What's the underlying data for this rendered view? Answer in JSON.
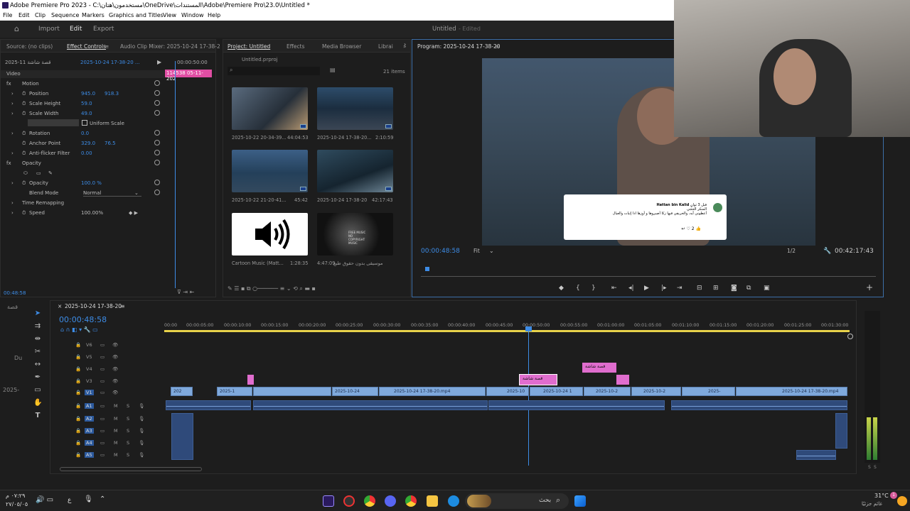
{
  "window": {
    "title": "Adobe Premiere Pro 2023 - C:\\مستخدمون\\هتان\\OneDrive\\المستندات\\Adobe\\Premiere Pro\\23.0\\Untitled *"
  },
  "menu": [
    "File",
    "Edit",
    "Clip",
    "Sequence",
    "Markers",
    "Graphics and Titles",
    "View",
    "Window",
    "Help"
  ],
  "workspace": {
    "import": "Import",
    "edit": "Edit",
    "export": "Export",
    "project_name": "Untitled",
    "status": "- Edited"
  },
  "source_panel": {
    "tabs": [
      "Source: (no clips)",
      "Effect Controls",
      "Audio Clip Mixer: 2025-10-24 17-38-2"
    ],
    "clip_master": "قصة شاشة 11-2025",
    "sequence": "2025-10-24 17-38-20 ...",
    "mini_time": "00:00:50:00",
    "clip_label": "114538 05-11-202",
    "video_header": "Video",
    "motion": "Motion",
    "position_label": "Position",
    "position_x": "945.0",
    "position_y": "918.3",
    "scale_height_label": "Scale Height",
    "scale_height": "59.0",
    "scale_width_label": "Scale Width",
    "scale_width": "49.0",
    "uniform_scale": "Uniform Scale",
    "rotation_label": "Rotation",
    "rotation": "0.0",
    "anchor_label": "Anchor Point",
    "anchor_x": "329.0",
    "anchor_y": "76.5",
    "antiflicker_label": "Anti-flicker Filter",
    "antiflicker": "0.00",
    "opacity_group": "Opacity",
    "opacity_label": "Opacity",
    "opacity": "100.0 %",
    "blend_label": "Blend Mode",
    "blend": "Normal",
    "time_remap": "Time Remapping",
    "speed_label": "Speed",
    "speed": "100.00%",
    "timecode": "00:48:58"
  },
  "project_panel": {
    "tabs": [
      "Project: Untitled",
      "Effects",
      "Media Browser",
      "Librai"
    ],
    "file": "Untitled.prproj",
    "count": "21 items",
    "items": [
      {
        "name": "2025-10-22 20-34-39...",
        "duration": "44:04:53"
      },
      {
        "name": "2025-10-24 17-38-20...",
        "duration": "2:10:59"
      },
      {
        "name": "2025-10-22 21-20-41...",
        "duration": "45:42"
      },
      {
        "name": "2025-10-24 17-38-20",
        "duration": "42:17:43"
      },
      {
        "name": "Cartoon Music (Matt...",
        "duration": "1:28:35"
      },
      {
        "name": "موسيقى بدون حقوق طبع",
        "duration": "4:47:09"
      }
    ],
    "thumb_text": "FREE MUSIC NO COPYRIGHT MUSIC"
  },
  "program_panel": {
    "tab": "Program: 2025-10-24 17-38-20",
    "timecode": "00:00:48:58",
    "fit": "Fit",
    "resolution": "1/2",
    "duration": "00:42:17:43",
    "comment": {
      "name": "Hattan bin Kalid",
      "time": "قبل 3 ثوانٍ",
      "line1": "المنكر الحجي",
      "line2": "أعطوني آيه، والحريقي فيها زكا أصبروها و أوزها اذا إثبات والعيال",
      "likes": "2"
    }
  },
  "timeline": {
    "sequence": "2025-10-24 17-38-20",
    "timecode": "00:00:48:58",
    "ticks": [
      "00:00",
      "00:00:05:00",
      "00:00:10:00",
      "00:00:15:00",
      "00:00:20:00",
      "00:00:25:00",
      "00:00:30:00",
      "00:00:35:00",
      "00:00:40:00",
      "00:00:45:00",
      "00:00:50:00",
      "00:00:55:00",
      "00:01:00:00",
      "00:01:05:00",
      "00:01:10:00",
      "00:01:15:00",
      "00:01:20:00",
      "00:01:25:00",
      "00:01:30:00"
    ],
    "video_tracks": [
      "V6",
      "V5",
      "V4",
      "V3",
      "V2",
      "V1"
    ],
    "audio_tracks": [
      "A1",
      "A2",
      "A3",
      "A4",
      "A5"
    ],
    "v1_clips": [
      "202",
      "2025-1",
      "2025-10-24",
      "2025-10-24 17-38-20.mp4",
      "2025-10",
      "2025-10-24 1",
      "2025-10-2",
      "2025-10-2",
      "2025-",
      "2025-10-24 17-38-20.mp4"
    ],
    "title_clip_v3": "قصة شاشة",
    "title_clip_v2": "قصة شاشة",
    "side_labels": [
      "قصة",
      "Du",
      "2025-"
    ],
    "meter_labels": [
      "S",
      "S"
    ]
  },
  "taskbar": {
    "time": "٠٧:٢٩ م",
    "date": "٢٧/٠٥/٠٥",
    "lang": "ع",
    "search": "بحث",
    "weather_temp": "31°C",
    "weather_desc": "غائم جزئيًا",
    "notif": "1"
  }
}
